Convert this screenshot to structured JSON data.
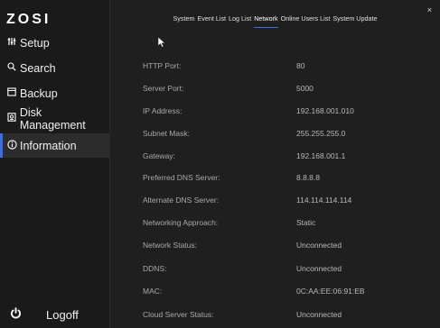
{
  "brand": "ZOSI",
  "sidebar": {
    "items": [
      {
        "label": "Setup",
        "icon": "sliders-icon"
      },
      {
        "label": "Search",
        "icon": "search-icon"
      },
      {
        "label": "Backup",
        "icon": "backup-icon"
      },
      {
        "label": "Disk Management",
        "icon": "disk-icon"
      },
      {
        "label": "Information",
        "icon": "info-icon",
        "active": true
      }
    ],
    "logoff": "Logoff"
  },
  "tabs": [
    {
      "label": "System"
    },
    {
      "label": "Event List"
    },
    {
      "label": "Log List"
    },
    {
      "label": "Network",
      "active": true
    },
    {
      "label": "Online Users List"
    },
    {
      "label": "System Update"
    }
  ],
  "close_glyph": "×",
  "network": [
    {
      "key": "HTTP Port:",
      "value": "80"
    },
    {
      "key": "Server Port:",
      "value": "5000"
    },
    {
      "key": "IP Address:",
      "value": "192.168.001.010"
    },
    {
      "key": "Subnet Mask:",
      "value": "255.255.255.0"
    },
    {
      "key": "Gateway:",
      "value": "192.168.001.1"
    },
    {
      "key": "Preferred DNS Server:",
      "value": "8.8.8.8"
    },
    {
      "key": "Alternate DNS Server:",
      "value": "114.114.114.114"
    },
    {
      "key": "Networking Approach:",
      "value": "Static"
    },
    {
      "key": "Network Status:",
      "value": "Unconnected"
    },
    {
      "key": "DDNS:",
      "value": "Unconnected"
    },
    {
      "key": "MAC:",
      "value": "0C:AA:EE:06:91:EB"
    },
    {
      "key": "Cloud Server Status:",
      "value": "Unconnected"
    }
  ],
  "colors": {
    "accent": "#3d6ee8",
    "background": "#1f1f1f",
    "sidebar": "#1a1a1a"
  }
}
